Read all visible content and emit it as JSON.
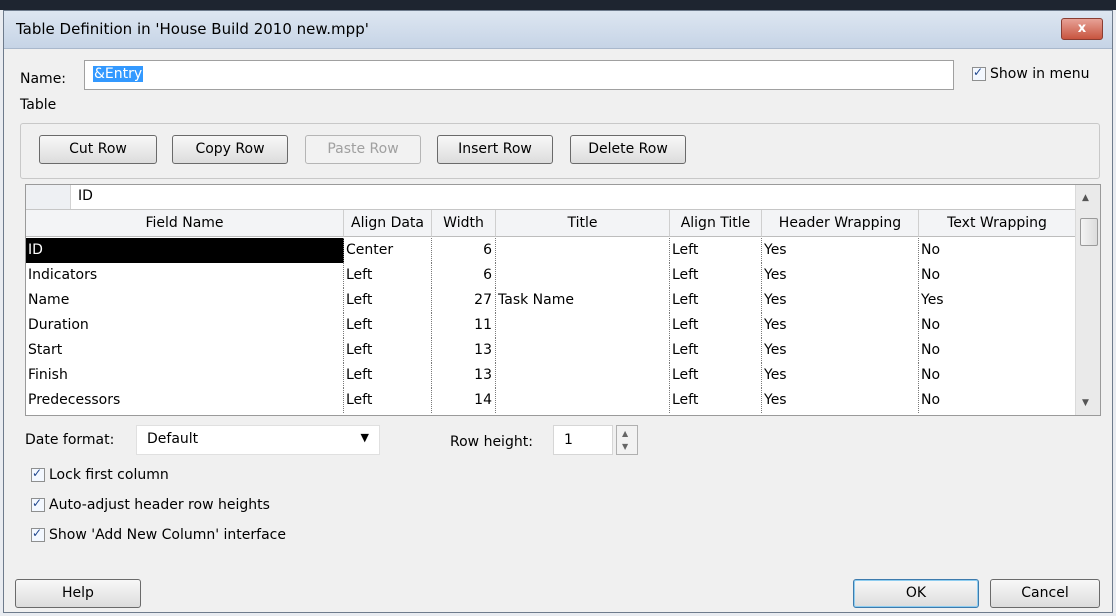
{
  "window": {
    "title": "Table Definition in 'House Build 2010 new.mpp'",
    "close_glyph": "x"
  },
  "name": {
    "label": "Name:",
    "value": "&Entry"
  },
  "show_in_menu": {
    "label": "Show in menu",
    "checked": true
  },
  "table_label": "Table",
  "toolbar": {
    "cut_row": "Cut Row",
    "copy_row": "Copy Row",
    "paste_row": "Paste Row",
    "insert_row": "Insert Row",
    "delete_row": "Delete Row"
  },
  "grid": {
    "edit_value": "ID",
    "columns": [
      "Field Name",
      "Align Data",
      "Width",
      "Title",
      "Align Title",
      "Header Wrapping",
      "Text Wrapping"
    ],
    "rows": [
      {
        "field": "ID",
        "align_data": "Center",
        "width": "6",
        "title": "",
        "align_title": "Left",
        "header_wrapping": "Yes",
        "text_wrapping": "No"
      },
      {
        "field": "Indicators",
        "align_data": "Left",
        "width": "6",
        "title": "",
        "align_title": "Left",
        "header_wrapping": "Yes",
        "text_wrapping": "No"
      },
      {
        "field": "Name",
        "align_data": "Left",
        "width": "27",
        "title": "Task Name",
        "align_title": "Left",
        "header_wrapping": "Yes",
        "text_wrapping": "Yes"
      },
      {
        "field": "Duration",
        "align_data": "Left",
        "width": "11",
        "title": "",
        "align_title": "Left",
        "header_wrapping": "Yes",
        "text_wrapping": "No"
      },
      {
        "field": "Start",
        "align_data": "Left",
        "width": "13",
        "title": "",
        "align_title": "Left",
        "header_wrapping": "Yes",
        "text_wrapping": "No"
      },
      {
        "field": "Finish",
        "align_data": "Left",
        "width": "13",
        "title": "",
        "align_title": "Left",
        "header_wrapping": "Yes",
        "text_wrapping": "No"
      },
      {
        "field": "Predecessors",
        "align_data": "Left",
        "width": "14",
        "title": "",
        "align_title": "Left",
        "header_wrapping": "Yes",
        "text_wrapping": "No"
      }
    ]
  },
  "date_format": {
    "label": "Date format:",
    "value": "Default"
  },
  "row_height": {
    "label": "Row height:",
    "value": "1"
  },
  "options": [
    {
      "label": "Lock first column",
      "checked": true
    },
    {
      "label": "Auto-adjust header row heights",
      "checked": true
    },
    {
      "label": "Show 'Add New Column' interface",
      "checked": true
    }
  ],
  "buttons": {
    "help": "Help",
    "ok": "OK",
    "cancel": "Cancel"
  },
  "colors": {
    "selection": "#3399ff",
    "selected_cell": "#000000",
    "close_button": "#c8543f"
  }
}
